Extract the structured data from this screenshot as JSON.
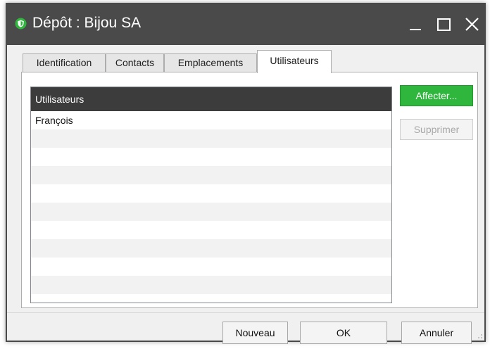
{
  "window": {
    "title": "Dépôt : Bijou SA",
    "app_icon": "shield-logo-icon",
    "accent_color": "#2fb63d",
    "titlebar_color": "#4a4a4a",
    "controls": [
      "minimize-icon",
      "maximize-icon",
      "close-icon"
    ]
  },
  "tabs": [
    {
      "label": "Identification",
      "active": false
    },
    {
      "label": "Contacts",
      "active": false
    },
    {
      "label": "Emplacements",
      "active": false
    },
    {
      "label": "Utilisateurs",
      "active": true
    }
  ],
  "users_list": {
    "header": "Utilisateurs",
    "rows": [
      "François"
    ]
  },
  "side_buttons": {
    "assign_label": "Affecter...",
    "delete_label": "Supprimer"
  },
  "footer": {
    "new_label": "Nouveau",
    "ok_label": "OK",
    "cancel_label": "Annuler"
  }
}
